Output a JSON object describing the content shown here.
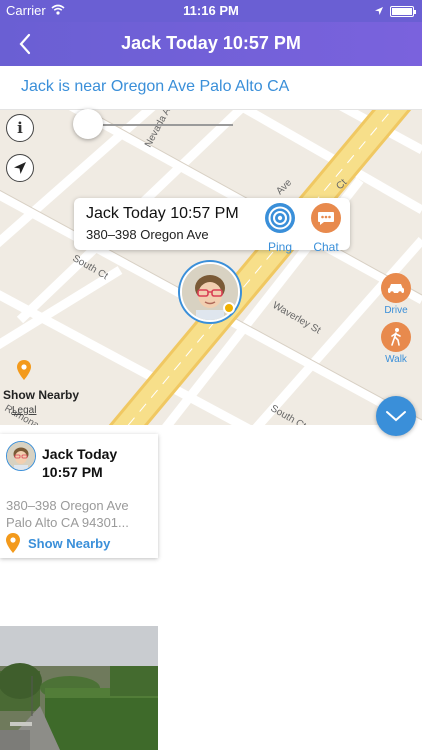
{
  "status_bar": {
    "carrier": "Carrier",
    "time": "11:16 PM"
  },
  "nav": {
    "title": "Jack Today  10:57 PM"
  },
  "location": {
    "text": "Jack is near Oregon Ave Palo Alto CA"
  },
  "map": {
    "info_button": "i",
    "popup": {
      "title": "Jack Today  10:57 PM",
      "address": "380–398 Oregon Ave",
      "ping_label": "Ping",
      "chat_label": "Chat"
    },
    "drive_label": "Drive",
    "walk_label": "Walk",
    "show_nearby_label": "Show Nearby",
    "legal_label": "Legal",
    "streets": {
      "nevada": "Nevada Ave",
      "south_ct_left": "South Ct",
      "waverley": "Waverley St",
      "south_ct_right": "South Ct",
      "ave": "Ave",
      "ct": "Ct",
      "ramona": "Ramona"
    }
  },
  "card": {
    "name": "Jack Today",
    "time": "10:57 PM",
    "address_line1": "380–398 Oregon Ave",
    "address_line2": "Palo Alto CA 94301...",
    "show_nearby_label": "Show Nearby"
  },
  "colors": {
    "nav": "#6a5fd3",
    "accent_blue": "#3a8fd9",
    "action_orange": "#e88a4d",
    "pin_orange": "#f39a1c",
    "map_bg": "#f0ebe3",
    "major_road": "#f5d878"
  },
  "icons": {
    "wifi": "wifi-icon",
    "location_arrow": "location-arrow-icon",
    "back": "chevron-left-icon",
    "info": "info-icon",
    "navigation": "navigation-arrow-icon",
    "ping": "target-icon",
    "chat": "chat-bubble-icon",
    "drive": "car-icon",
    "walk": "walking-person-icon",
    "pin": "map-pin-icon",
    "expand": "chevron-down-icon"
  }
}
